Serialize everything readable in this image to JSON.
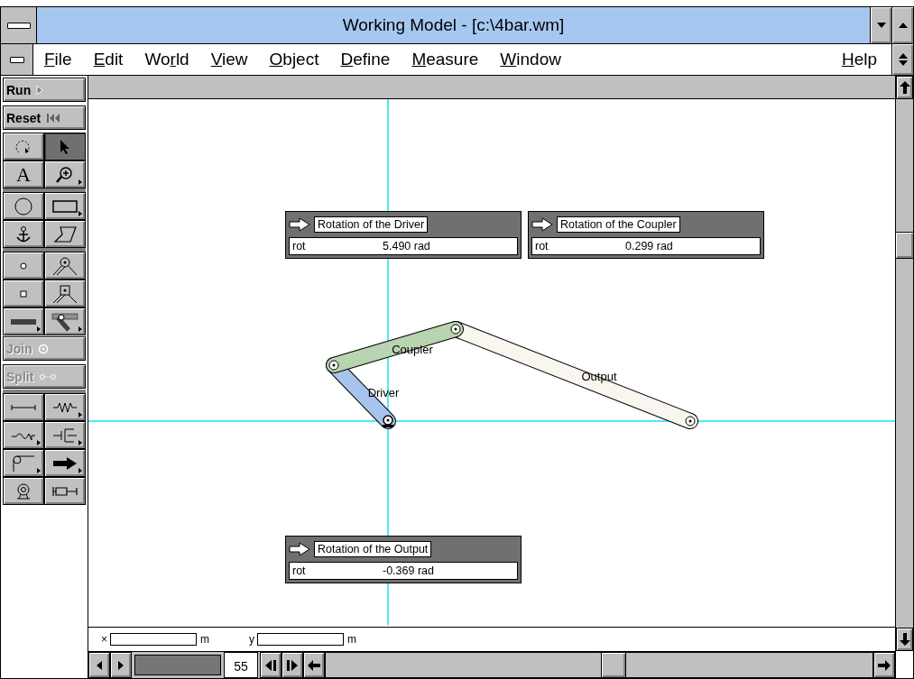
{
  "window": {
    "title": "Working Model - [c:\\4bar.wm]"
  },
  "menu": [
    {
      "key": "F",
      "post": "ile"
    },
    {
      "key": "E",
      "post": "dit"
    },
    {
      "pre": "Wo",
      "key": "r",
      "post": "ld"
    },
    {
      "key": "V",
      "post": "iew"
    },
    {
      "key": "O",
      "post": "bject"
    },
    {
      "key": "D",
      "post": "efine"
    },
    {
      "key": "M",
      "post": "easure"
    },
    {
      "key": "W",
      "post": "indow"
    }
  ],
  "help_menu": {
    "key": "H",
    "post": "elp"
  },
  "palette": [
    {
      "kind": "command",
      "label": "Run",
      "disabled": false
    },
    {
      "kind": "command",
      "label": "Reset",
      "disabled": false
    },
    {
      "kind": "tools",
      "rows": [
        [
          {
            "kind": "rotate",
            "selected": false,
            "flyout": false
          },
          {
            "kind": "pointer",
            "selected": true,
            "flyout": false
          }
        ],
        [
          {
            "kind": "text",
            "glyph": "A",
            "selected": false,
            "flyout": false
          },
          {
            "kind": "zoom",
            "selected": false,
            "flyout": true
          }
        ]
      ]
    },
    {
      "kind": "tools",
      "rows": [
        [
          {
            "kind": "circle",
            "selected": false,
            "flyout": false
          },
          {
            "kind": "rectangle",
            "selected": false,
            "flyout": true
          }
        ],
        [
          {
            "kind": "anchor",
            "selected": false,
            "flyout": false
          },
          {
            "kind": "polygon",
            "selected": false,
            "flyout": false
          }
        ]
      ]
    },
    {
      "kind": "tools",
      "rows": [
        [
          {
            "kind": "point",
            "selected": false,
            "flyout": false
          },
          {
            "kind": "pin-joint",
            "selected": false,
            "flyout": false
          }
        ],
        [
          {
            "kind": "square-point",
            "selected": false,
            "flyout": false
          },
          {
            "kind": "slot-joint",
            "selected": false,
            "flyout": false
          }
        ],
        [
          {
            "kind": "slot",
            "selected": false,
            "flyout": true
          },
          {
            "kind": "keyed-slot",
            "selected": false,
            "flyout": true
          }
        ]
      ]
    },
    {
      "kind": "command",
      "label": "Join",
      "disabled": true
    },
    {
      "kind": "command",
      "label": "Split",
      "disabled": true
    },
    {
      "kind": "tools",
      "rows": [
        [
          {
            "kind": "rod",
            "selected": false,
            "flyout": false
          },
          {
            "kind": "spring",
            "selected": false,
            "flyout": true
          }
        ],
        [
          {
            "kind": "torsion",
            "selected": false,
            "flyout": true
          },
          {
            "kind": "damper",
            "selected": false,
            "flyout": true
          }
        ],
        [
          {
            "kind": "rope",
            "selected": false,
            "flyout": true
          },
          {
            "kind": "force",
            "selected": false,
            "flyout": true
          }
        ],
        [
          {
            "kind": "motor",
            "selected": false,
            "flyout": false
          },
          {
            "kind": "actuator",
            "selected": false,
            "flyout": false
          }
        ]
      ]
    }
  ],
  "meters": [
    {
      "title": "Rotation of the Driver",
      "field": "rot",
      "value": "5.490 rad"
    },
    {
      "title": "Rotation of the Coupler",
      "field": "rot",
      "value": "0.299 rad"
    },
    {
      "title": "Rotation of the Output",
      "field": "rot",
      "value": "-0.369 rad"
    }
  ],
  "bodies": [
    {
      "name": "Driver",
      "color": "#a8c4ec"
    },
    {
      "name": "Coupler",
      "color": "#b8d4b0"
    },
    {
      "name": "Output",
      "color": "#f8f6ee"
    }
  ],
  "coordinates": [
    {
      "axis": "×",
      "unit": "m"
    },
    {
      "axis": "y",
      "unit": "m"
    }
  ],
  "tape": {
    "level": 1,
    "frame": "55"
  }
}
